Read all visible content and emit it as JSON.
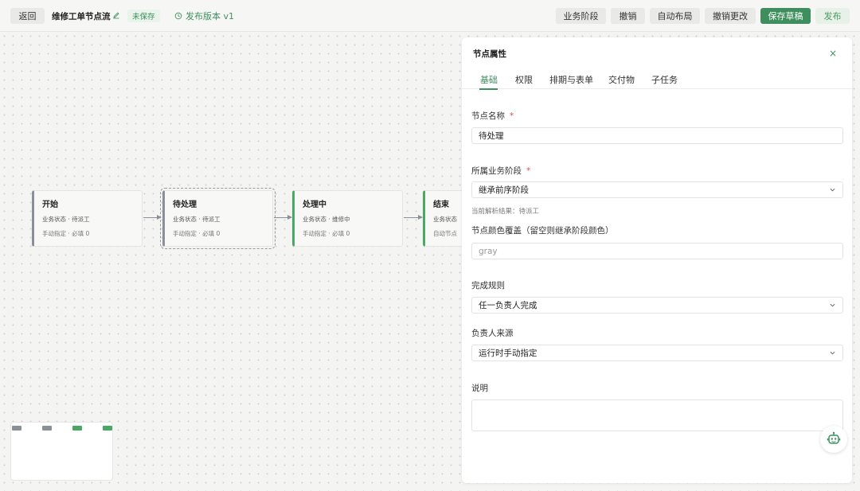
{
  "toolbar": {
    "back": "返回",
    "title": "维修工单节点流",
    "unsaved": "未保存",
    "version": "发布版本 v1",
    "stages": "业务阶段",
    "undo": "撤销",
    "auto_layout": "自动布局",
    "revert": "撤销更改",
    "save_draft": "保存草稿",
    "publish": "发布"
  },
  "nodes": [
    {
      "title": "开始",
      "status": "业务状态 · 待派工",
      "footer": "手动指定 · 必填 0",
      "color": "#8a8f9a"
    },
    {
      "title": "待处理",
      "status": "业务状态 · 待派工",
      "footer": "手动指定 · 必填 0",
      "color": "#8a8f9a",
      "selected": true
    },
    {
      "title": "处理中",
      "status": "业务状态 · 维修中",
      "footer": "手动指定 · 必填 0",
      "color": "#4aa866"
    },
    {
      "title": "结束",
      "status": "业务状态",
      "footer": "自动节点",
      "color": "#4aa866"
    }
  ],
  "minimap": {
    "colors": [
      "#8a8f9a",
      "#8a8f9a",
      "#4aa866",
      "#4aa866"
    ]
  },
  "panel": {
    "title": "节点属性",
    "close": "×",
    "tabs": [
      "基础",
      "权限",
      "排期与表单",
      "交付物",
      "子任务"
    ],
    "active_tab": "基础",
    "node_name_label": "节点名称",
    "node_name_value": "待处理",
    "stage_label": "所属业务阶段",
    "stage_value": "继承前序阶段",
    "stage_hint": "当前解析结果：待派工",
    "color_label": "节点颜色覆盖（留空则继承阶段颜色）",
    "color_placeholder": "gray",
    "completion_label": "完成规则",
    "completion_value": "任一负责人完成",
    "owner_label": "负责人来源",
    "owner_value": "运行时手动指定",
    "desc_label": "说明",
    "required_mark": "*"
  },
  "colors": {
    "accent": "#3f8f5e",
    "required": "#d9534f"
  }
}
